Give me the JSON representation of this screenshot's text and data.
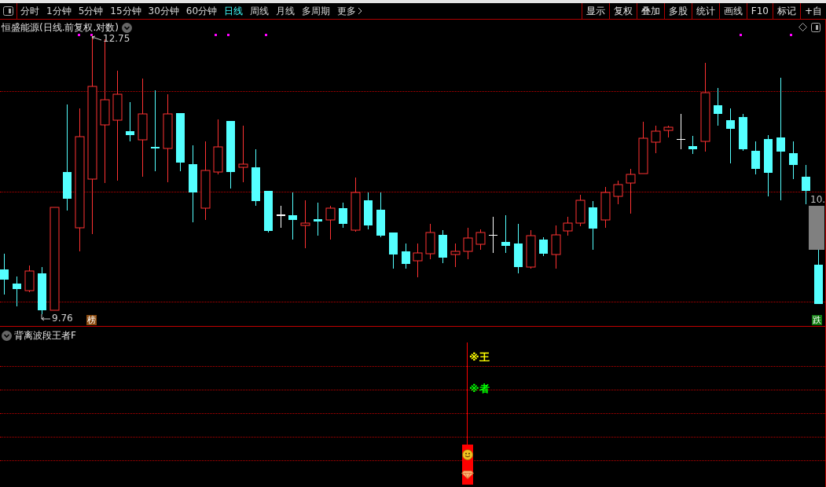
{
  "toolbar": {
    "periods": [
      {
        "label": "分时",
        "selected": false
      },
      {
        "label": "1分钟",
        "selected": false
      },
      {
        "label": "5分钟",
        "selected": false
      },
      {
        "label": "15分钟",
        "selected": false
      },
      {
        "label": "30分钟",
        "selected": false
      },
      {
        "label": "60分钟",
        "selected": false
      },
      {
        "label": "日线",
        "selected": true
      },
      {
        "label": "周线",
        "selected": false
      },
      {
        "label": "月线",
        "selected": false
      },
      {
        "label": "多周期",
        "selected": false
      },
      {
        "label": "更多",
        "selected": false
      }
    ],
    "buttons": [
      "显示",
      "复权",
      "叠加",
      "多股",
      "统计",
      "画线",
      "F10",
      "标记",
      "+自"
    ]
  },
  "main_chart": {
    "title": "恒盛能源(日线.前复权.对数)",
    "high_label": "12.75",
    "low_label": "9.76",
    "price_label": "10.",
    "badges": [
      {
        "text": "榜",
        "color": "#8b4a0e"
      },
      {
        "text": "跌",
        "color": "#0f7a0f"
      }
    ]
  },
  "indicator": {
    "title": "背离波段王者F",
    "signals": [
      {
        "text": "※王",
        "color": "#ffff00"
      },
      {
        "text": "※者",
        "color": "#00ff00"
      }
    ]
  }
}
